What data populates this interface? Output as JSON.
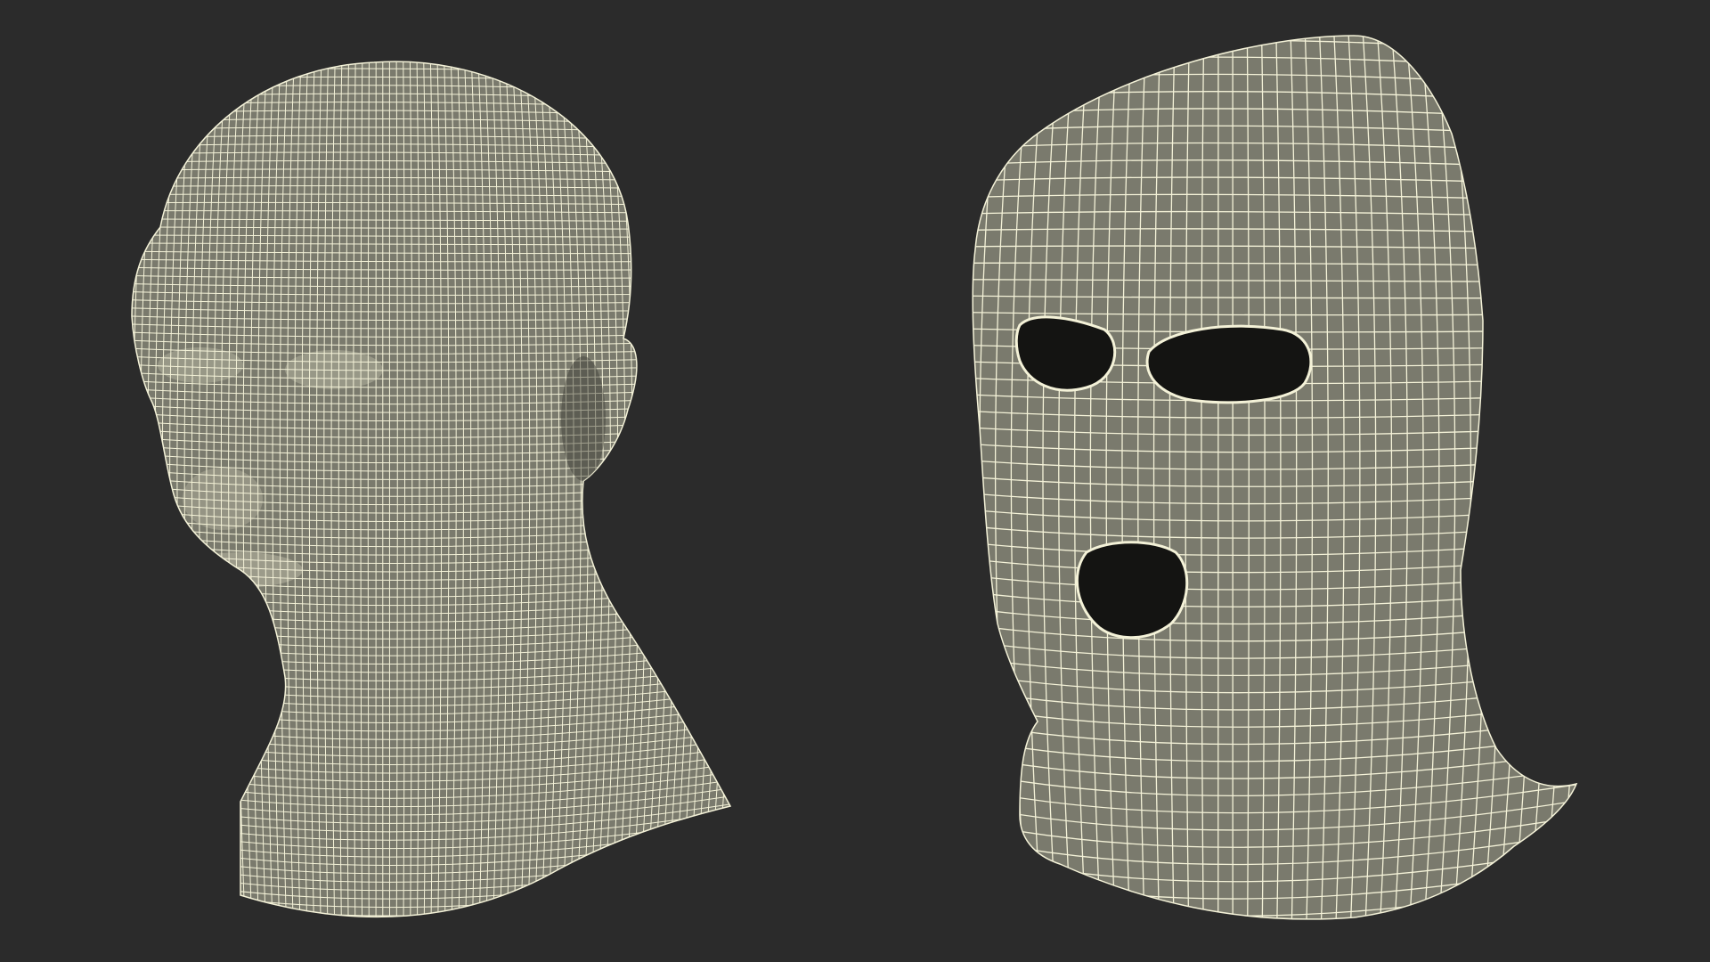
{
  "scene": {
    "background_color": "#2b2b2b",
    "surface_color": "#7a7a6d",
    "wire_color": "#f4f2d8",
    "hole_color": "#141412"
  },
  "models": [
    {
      "id": "head",
      "label": ""
    },
    {
      "id": "balaclava",
      "label": ""
    }
  ]
}
